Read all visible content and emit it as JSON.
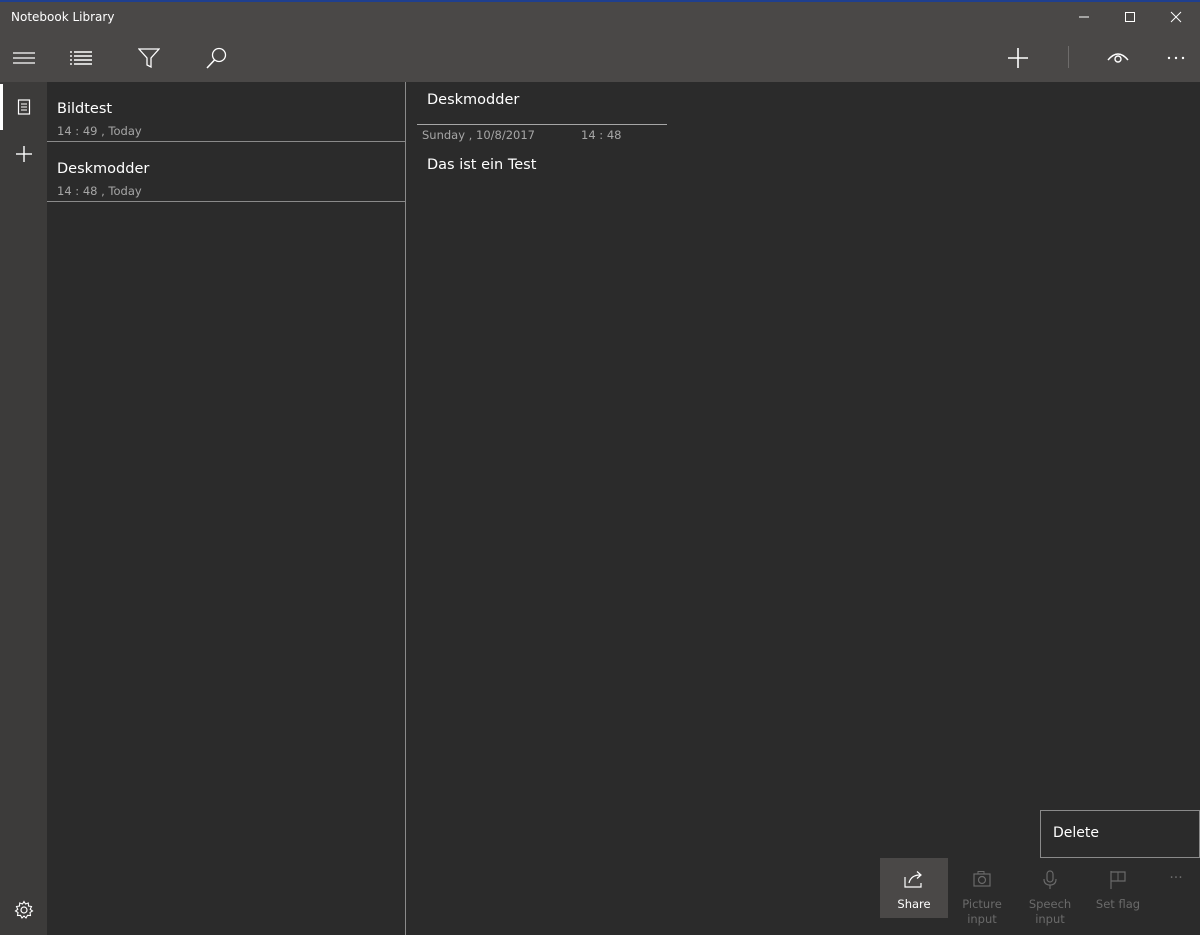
{
  "window": {
    "title": "Notebook Library",
    "controls": [
      "minimize",
      "maximize",
      "close"
    ]
  },
  "toolbar": {
    "left_icons": [
      "list-icon",
      "filter-icon",
      "search-icon"
    ],
    "right_icons": [
      "plus-icon",
      "eye-icon",
      "more-icon"
    ]
  },
  "nav": {
    "items": [
      "notebook-icon",
      "add-icon"
    ],
    "bottom": "settings-icon"
  },
  "notes": [
    {
      "title": "Bildtest",
      "meta": "14 : 49 , Today"
    },
    {
      "title": "Deskmodder",
      "meta": "14 : 48 , Today"
    }
  ],
  "detail": {
    "title": "Deskmodder",
    "date": "Sunday , 10/8/2017",
    "time": "14 : 48",
    "body": "Das ist ein Test"
  },
  "context_menu": {
    "items": [
      "Delete"
    ]
  },
  "commands": [
    {
      "label": "Share",
      "state": "enabled"
    },
    {
      "label": "Picture input",
      "state": "disabled"
    },
    {
      "label": "Speech input",
      "state": "disabled"
    },
    {
      "label": "Set flag",
      "state": "disabled"
    }
  ],
  "more_label": "···",
  "colors": {
    "chrome": "#4a4847",
    "background": "#2b2b2b",
    "rail": "#3c3b3a",
    "text": "#ffffff",
    "muted": "#a6a6a6"
  }
}
